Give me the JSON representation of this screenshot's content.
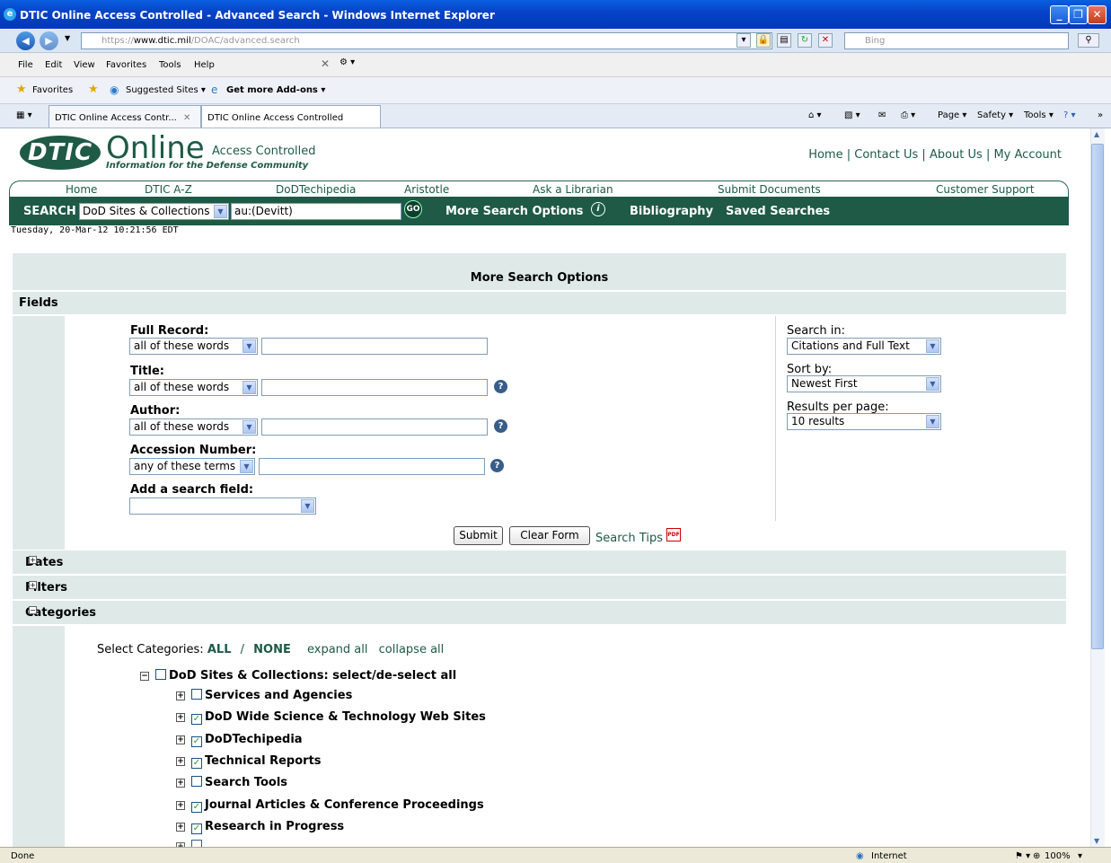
{
  "window": {
    "title": "DTIC Online Access Controlled - Advanced Search - Windows Internet Explorer"
  },
  "address": {
    "url_prefix": "https://",
    "url_domain": "www.dtic.mil",
    "url_path": "/DOAC/advanced.search",
    "search_placeholder": "Bing"
  },
  "menu": [
    "File",
    "Edit",
    "View",
    "Favorites",
    "Tools",
    "Help"
  ],
  "favbar": {
    "favorites": "Favorites",
    "suggested": "Suggested Sites ▾",
    "addons": "Get more Add-ons ▾"
  },
  "tabs": [
    {
      "label": "DTIC Online Access Contr..."
    },
    {
      "label": "DTIC Online Access Controlled"
    }
  ],
  "tabtools": {
    "page": "Page ▾",
    "safety": "Safety ▾",
    "tools": "Tools ▾"
  },
  "site": {
    "logo": "DTIC",
    "logo_online": "Online",
    "logo_ac": "Access Controlled",
    "tagline": "Information for the Defense Community",
    "toplinks": {
      "home": "Home",
      "contact": "Contact Us",
      "about": "About Us",
      "account": "My Account",
      "sep": "|"
    },
    "nav": [
      "Home",
      "DTIC A-Z",
      "DoDTechipedia",
      "Aristotle",
      "Ask a Librarian",
      "Submit Documents",
      "Customer Support"
    ],
    "searchbar": {
      "label": "SEARCH",
      "scope": "DoD Sites & Collections",
      "query": "au:(Devitt)",
      "go": "GO",
      "more": "More Search Options",
      "biblio": "Bibliography",
      "saved": "Saved Searches"
    },
    "datestamp": "Tuesday, 20-Mar-12 10:21:56 EDT"
  },
  "form": {
    "heading": "More Search Options",
    "fields_band": "Fields",
    "full_record": {
      "label": "Full Record:",
      "mode": "all of these words"
    },
    "title": {
      "label": "Title:",
      "mode": "all of these words"
    },
    "author": {
      "label": "Author:",
      "mode": "all of these words"
    },
    "accession": {
      "label": "Accession Number:",
      "mode": "any of these terms"
    },
    "add_field": {
      "label": "Add a search field:",
      "value": ""
    },
    "search_in": {
      "label": "Search in:",
      "value": "Citations and Full Text"
    },
    "sort_by": {
      "label": "Sort by:",
      "value": "Newest First"
    },
    "per_page": {
      "label": "Results per page:",
      "value": "10 results"
    },
    "submit": "Submit",
    "clear": "Clear Form",
    "tips": "Search Tips",
    "pdf": "PDF"
  },
  "sections": {
    "dates": "Dates",
    "filters": "Filters",
    "categories": "Categories"
  },
  "categories": {
    "select_label": "Select Categories:",
    "all": "ALL",
    "slash": "/",
    "none": "NONE",
    "expand": "expand all",
    "collapse": "collapse all",
    "root": {
      "label": "DoD Sites & Collections:  select/de-select all",
      "checked": false
    },
    "items": [
      {
        "label": "Services and Agencies",
        "checked": false
      },
      {
        "label": "DoD Wide Science & Technology Web Sites",
        "checked": true
      },
      {
        "label": "DoDTechipedia",
        "checked": true
      },
      {
        "label": "Technical Reports",
        "checked": true
      },
      {
        "label": "Search Tools",
        "checked": false
      },
      {
        "label": "Journal Articles & Conference Proceedings",
        "checked": true
      },
      {
        "label": "Research in Progress",
        "checked": true
      }
    ]
  },
  "status": {
    "left": "Done",
    "zone": "Internet",
    "zoom": "100%"
  }
}
